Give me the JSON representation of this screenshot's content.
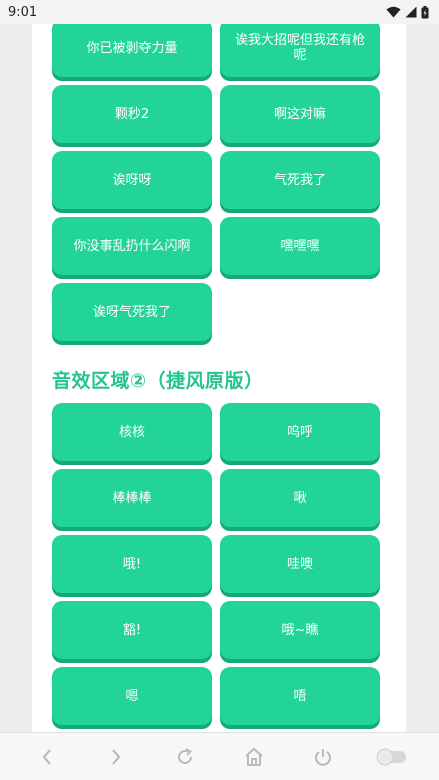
{
  "status": {
    "time": "9:01",
    "icons": [
      "wifi-icon",
      "signal-icon",
      "battery-icon"
    ]
  },
  "section1": {
    "buttons": [
      "你已被剥夺力量",
      "诶我大招呢但我还有枪呢",
      "颗秒2",
      "啊这对嘛",
      "诶呀呀",
      "气死我了",
      "你没事乱扔什么闪啊",
      "嘿嘿嘿",
      "诶呀气死我了"
    ]
  },
  "section2": {
    "title": "音效区域②（捷风原版）",
    "buttons": [
      "核核",
      "呜呼",
      "棒棒棒",
      "啾",
      "哦!",
      "哇噢",
      "豁!",
      "哦~瞧",
      "嗯",
      "唔"
    ]
  },
  "nav": {
    "icons": [
      "back-icon",
      "forward-icon",
      "refresh-icon",
      "home-icon",
      "power-icon",
      "toggle-icon"
    ]
  },
  "colors": {
    "button": "#23d497",
    "button_shadow": "#16a878",
    "section_title": "#23c48e"
  }
}
